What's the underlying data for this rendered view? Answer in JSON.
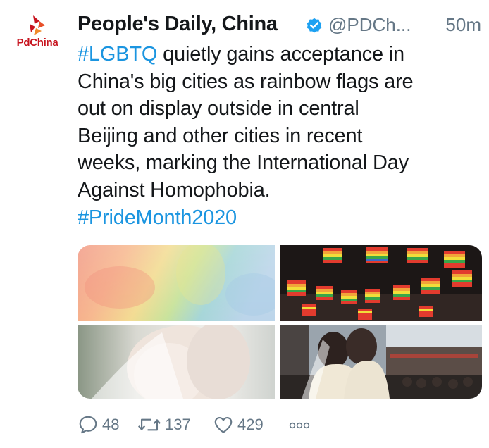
{
  "account": {
    "avatar_label": "PdChina",
    "display_name": "People's Daily, China",
    "handle": "@PDCh...",
    "timestamp": "50m",
    "verified": true
  },
  "tweet": {
    "hashtag_1": "#LGBTQ",
    "text_line_1": " quietly gains acceptance in",
    "text_lines": [
      "China's big cities as rainbow flags are",
      "out on display outside  in central",
      "Beijing and other cities in recent",
      "weeks, marking the International Day",
      "Against Homophobia."
    ],
    "hashtag_2": "#PrideMonth2020"
  },
  "media": {
    "images": [
      {
        "name": "rainbow-watercolor-image"
      },
      {
        "name": "rainbow-flags-string-image"
      },
      {
        "name": "brides-embrace-image"
      },
      {
        "name": "wedding-couple-street-image"
      }
    ]
  },
  "actions": {
    "replies": "48",
    "retweets": "137",
    "likes": "429",
    "more_icon": "ellipsis-icon"
  },
  "colors": {
    "hashtag": "#1b95e0",
    "secondary": "#657786",
    "text": "#14171a",
    "brand": "#c7141f",
    "verified": "#1da1f2"
  }
}
